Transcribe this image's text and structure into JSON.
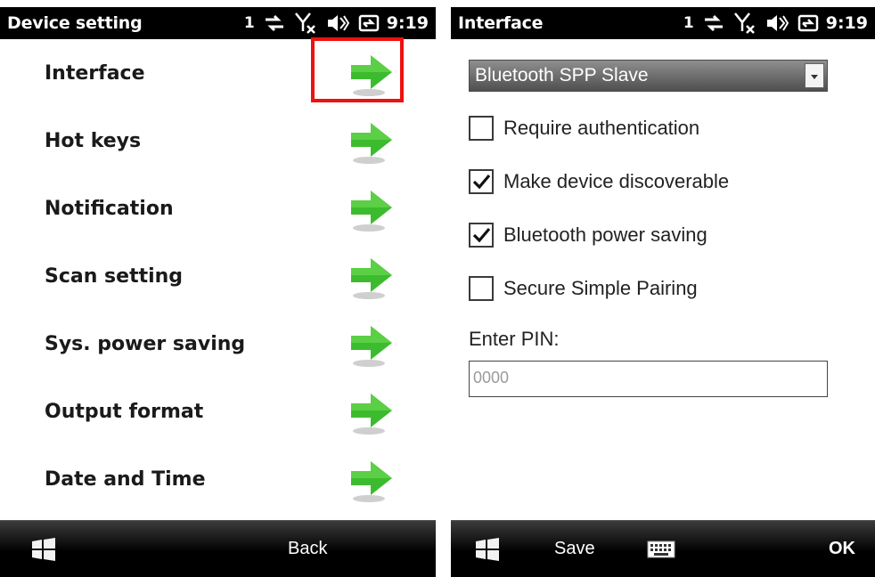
{
  "left_screen": {
    "status": {
      "title": "Device setting",
      "signal_count": "1",
      "time": "9:19"
    },
    "menu_items": [
      {
        "label": "Interface"
      },
      {
        "label": "Hot keys"
      },
      {
        "label": "Notification"
      },
      {
        "label": "Scan setting"
      },
      {
        "label": "Sys. power saving"
      },
      {
        "label": "Output format"
      },
      {
        "label": "Date and Time"
      }
    ],
    "highlight_color": "#ee1111",
    "softbar": {
      "right_label": "Back"
    }
  },
  "right_screen": {
    "status": {
      "title": "Interface",
      "signal_count": "1",
      "time": "9:19"
    },
    "interface_select": {
      "value": "Bluetooth SPP Slave"
    },
    "checkboxes": [
      {
        "label": "Require authentication",
        "checked": false
      },
      {
        "label": "Make device discoverable",
        "checked": true
      },
      {
        "label": "Bluetooth power saving",
        "checked": true
      },
      {
        "label": "Secure Simple Pairing",
        "checked": false
      }
    ],
    "pin": {
      "label": "Enter PIN:",
      "value": "0000"
    },
    "softbar": {
      "save_label": "Save",
      "ok_label": "OK"
    }
  },
  "colors": {
    "arrow_green": "#3dbb2e",
    "status_bar": "#000000"
  }
}
